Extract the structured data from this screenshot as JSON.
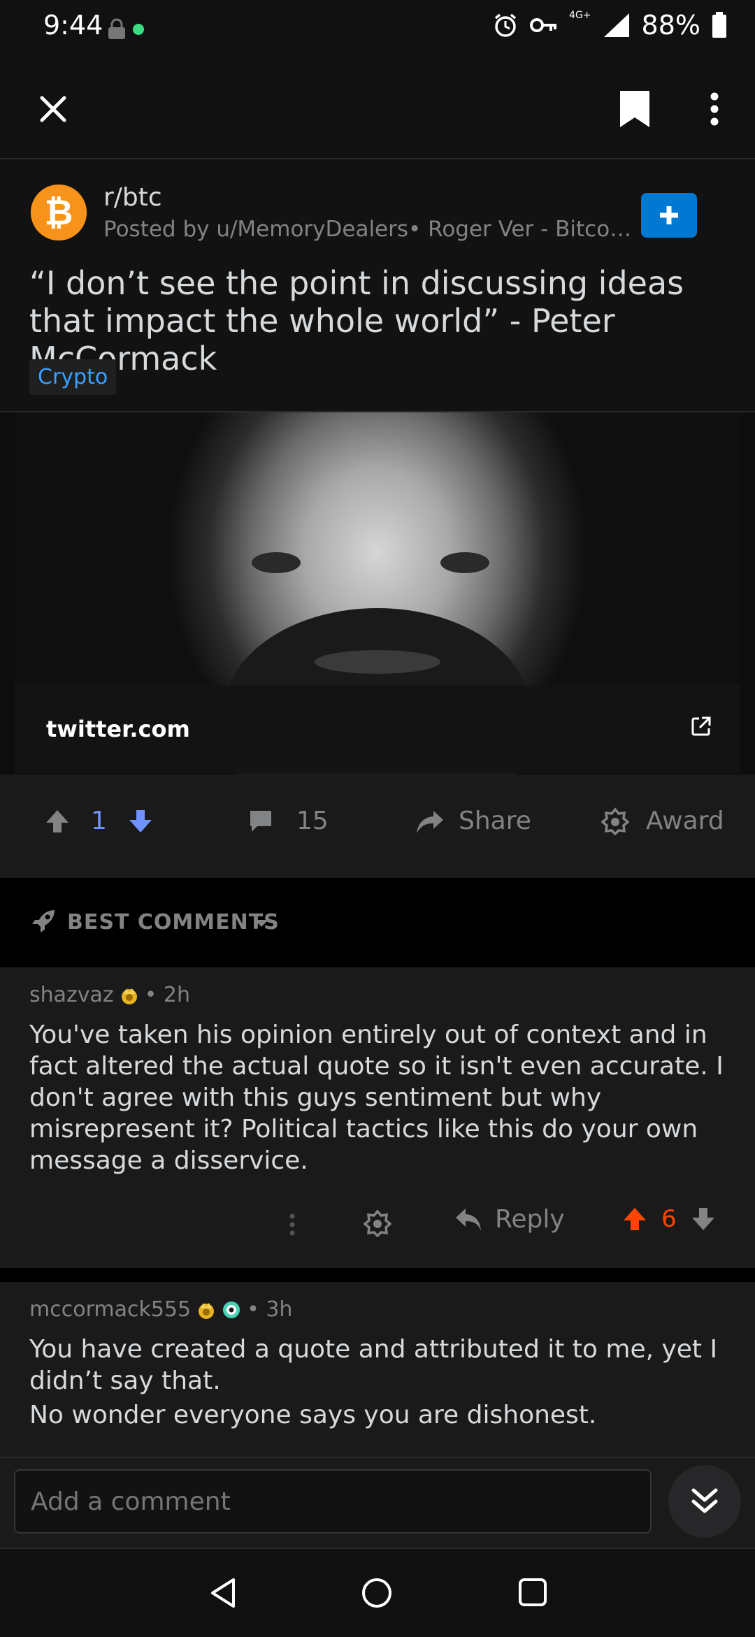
{
  "status_bar": {
    "time": "9:44",
    "network": "4G+",
    "battery": "88%"
  },
  "top_bar": {
    "close_icon": "close-icon",
    "save_icon": "bookmark-icon",
    "more_icon": "more-vertical-icon"
  },
  "post": {
    "subreddit": "r/btc",
    "posted_by": "Posted by u/MemoryDealers• Roger Ver - Bitcoin E...",
    "join_label": "+",
    "title": "“I don’t see the point in discussing ideas that impact the whole world” - Peter McCormack",
    "flair": "Crypto",
    "link_domain": "twitter.com",
    "votes": "1",
    "comments": "15",
    "share_label": "Share",
    "award_label": "Award"
  },
  "sort": {
    "label": "BEST COMMENTS"
  },
  "comments": [
    {
      "author": "shazvaz",
      "time": "• 2h",
      "body": "You've taken his opinion entirely out of context and in fact altered the actual quote so it isn't even accurate. I don't agree with this guys sentiment but why misrepresent it? Political tactics like this do your own message a disservice.",
      "reply_label": "Reply",
      "score": "6"
    },
    {
      "author": "mccormack555",
      "time": "• 3h",
      "body_line1": "You have created a quote and attributed it to me, yet I didn’t say that.",
      "body_line2": "No wonder everyone says you are dishonest."
    }
  ],
  "composer": {
    "placeholder": "Add a comment"
  },
  "colors": {
    "accent": "#0079d3",
    "upvote": "#ff4500",
    "downvote_active": "#7193ff",
    "flair": "#3aa0ff"
  }
}
